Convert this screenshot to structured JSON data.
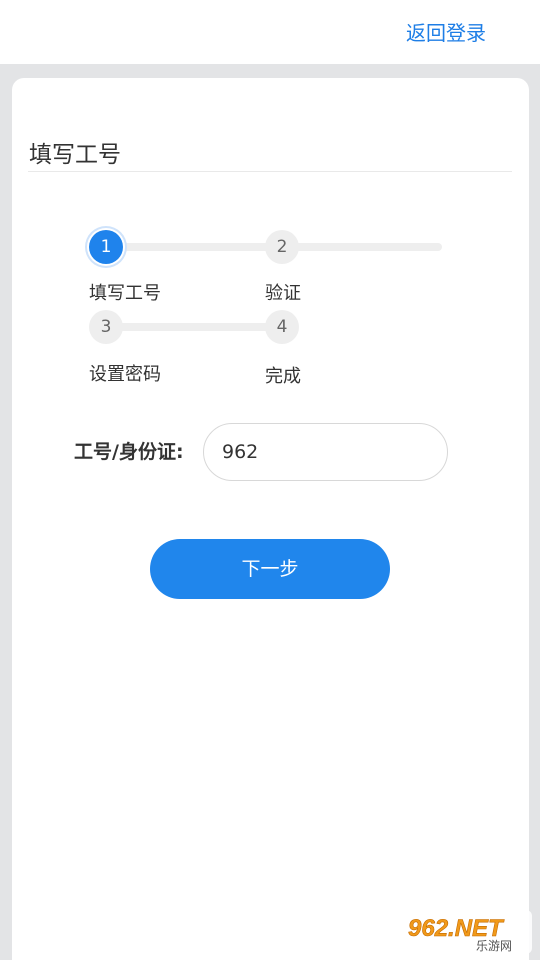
{
  "header": {
    "back_login_label": "返回登录"
  },
  "page": {
    "title": "填写工号"
  },
  "steps": [
    {
      "number": "1",
      "label": "填写工号",
      "active": true
    },
    {
      "number": "2",
      "label": "验证",
      "active": false
    },
    {
      "number": "3",
      "label": "设置密码",
      "active": false
    },
    {
      "number": "4",
      "label": "完成",
      "active": false
    }
  ],
  "form": {
    "id_label": "工号/身份证:",
    "id_value": "962"
  },
  "actions": {
    "next_label": "下一步"
  },
  "watermark": {
    "brand": "962.NET",
    "sub": "乐游网"
  },
  "colors": {
    "accent": "#1f83ec",
    "link": "#1e7ee6",
    "background": "#e3e4e6"
  }
}
